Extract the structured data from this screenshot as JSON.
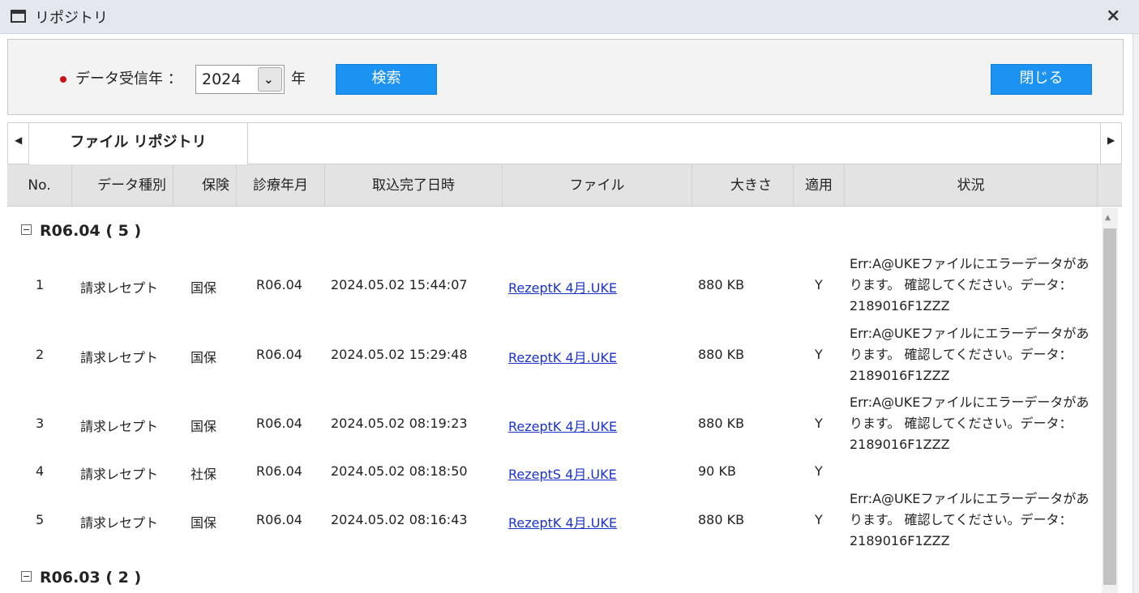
{
  "window": {
    "title": "リポジトリ",
    "close_icon": "×"
  },
  "toolbar": {
    "year_label": "データ受信年 ：",
    "year_value": "2024",
    "year_suffix": "年",
    "search_label": "検索",
    "close_label": "閉じる"
  },
  "tabs": [
    {
      "label": "ファイル リポジトリ"
    }
  ],
  "columns": [
    "No.",
    "データ種別",
    "保険",
    "診療年月",
    "取込完了日時",
    "ファイル",
    "大きさ",
    "適用",
    "状況"
  ],
  "groups": [
    {
      "label": "R06.04 ( 5 )"
    },
    {
      "label": "R06.03 ( 2 )"
    }
  ],
  "rows": [
    {
      "no": "1",
      "type": "請求レセプト",
      "insurance": "国保",
      "ym": "R06.04",
      "datetime": "2024.05.02 15:44:07",
      "file": "RezeptK 4月.UKE",
      "size": "880 KB",
      "apply": "Y",
      "status": "Err:A@UKEファイルにエラーデータがあります。 確認してください。データ： 2189016F1ZZZ"
    },
    {
      "no": "2",
      "type": "請求レセプト",
      "insurance": "国保",
      "ym": "R06.04",
      "datetime": "2024.05.02 15:29:48",
      "file": "RezeptK 4月.UKE",
      "size": "880 KB",
      "apply": "Y",
      "status": "Err:A@UKEファイルにエラーデータがあります。 確認してください。データ： 2189016F1ZZZ"
    },
    {
      "no": "3",
      "type": "請求レセプト",
      "insurance": "国保",
      "ym": "R06.04",
      "datetime": "2024.05.02 08:19:23",
      "file": "RezeptK 4月.UKE",
      "size": "880 KB",
      "apply": "Y",
      "status": "Err:A@UKEファイルにエラーデータがあります。 確認してください。データ： 2189016F1ZZZ"
    },
    {
      "no": "4",
      "type": "請求レセプト",
      "insurance": "社保",
      "ym": "R06.04",
      "datetime": "2024.05.02 08:18:50",
      "file": "RezeptS 4月.UKE",
      "size": "90 KB",
      "apply": "Y",
      "status": ""
    },
    {
      "no": "5",
      "type": "請求レセプト",
      "insurance": "国保",
      "ym": "R06.04",
      "datetime": "2024.05.02 08:16:43",
      "file": "RezeptK 4月.UKE",
      "size": "880 KB",
      "apply": "Y",
      "status": "Err:A@UKEファイルにエラーデータがあります。 確認してください。データ： 2189016F1ZZZ"
    }
  ]
}
